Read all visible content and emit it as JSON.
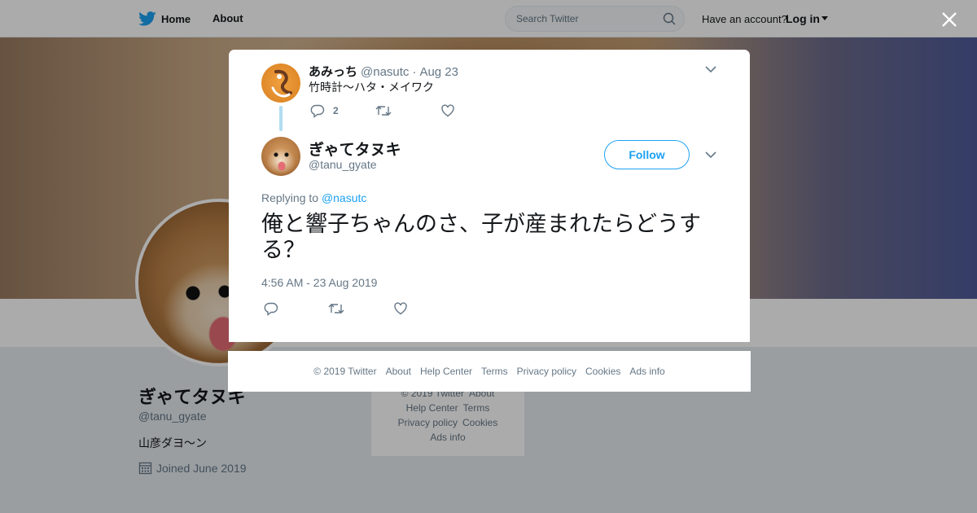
{
  "nav": {
    "home_label": "Home",
    "about_label": "About",
    "search_placeholder": "Search Twitter",
    "have_account": "Have an account?",
    "login_label": "Log in"
  },
  "profile": {
    "name": "ぎゃてタヌキ",
    "handle": "@tanu_gyate",
    "bio": "山彦ダヨ～ン",
    "joined": "Joined June 2019"
  },
  "side_footer": {
    "links": [
      "© 2019 Twitter",
      "About",
      "Help Center",
      "Terms",
      "Privacy policy",
      "Cookies",
      "Ads info"
    ]
  },
  "modal": {
    "parent_tweet": {
      "name": "あみっち",
      "handle": "@nasutc",
      "separator": "·",
      "date": "Aug 23",
      "text": "竹時計～ハタ・メイワク",
      "reply_count": "2"
    },
    "tweet": {
      "name": "ぎゃてタヌキ",
      "handle": "@tanu_gyate",
      "follow_label": "Follow",
      "replying_prefix": "Replying to",
      "replying_to": "@nasutc",
      "text": "俺と響子ちゃんのさ、子が産まれたらどうする？",
      "timestamp": "4:56 AM - 23 Aug 2019"
    }
  },
  "modal_footer": {
    "links": [
      "© 2019 Twitter",
      "About",
      "Help Center",
      "Terms",
      "Privacy policy",
      "Cookies",
      "Ads info"
    ]
  },
  "colors": {
    "accent": "#1da1f2",
    "muted_text": "#657786",
    "thread_line": "#b0dcf2"
  },
  "icons": {
    "logo": "twitter-bird-icon",
    "search": "search-icon",
    "close": "close-icon",
    "reply": "reply-icon",
    "retweet": "retweet-icon",
    "like": "heart-icon",
    "more": "chevron-down-icon",
    "calendar": "calendar-icon"
  }
}
